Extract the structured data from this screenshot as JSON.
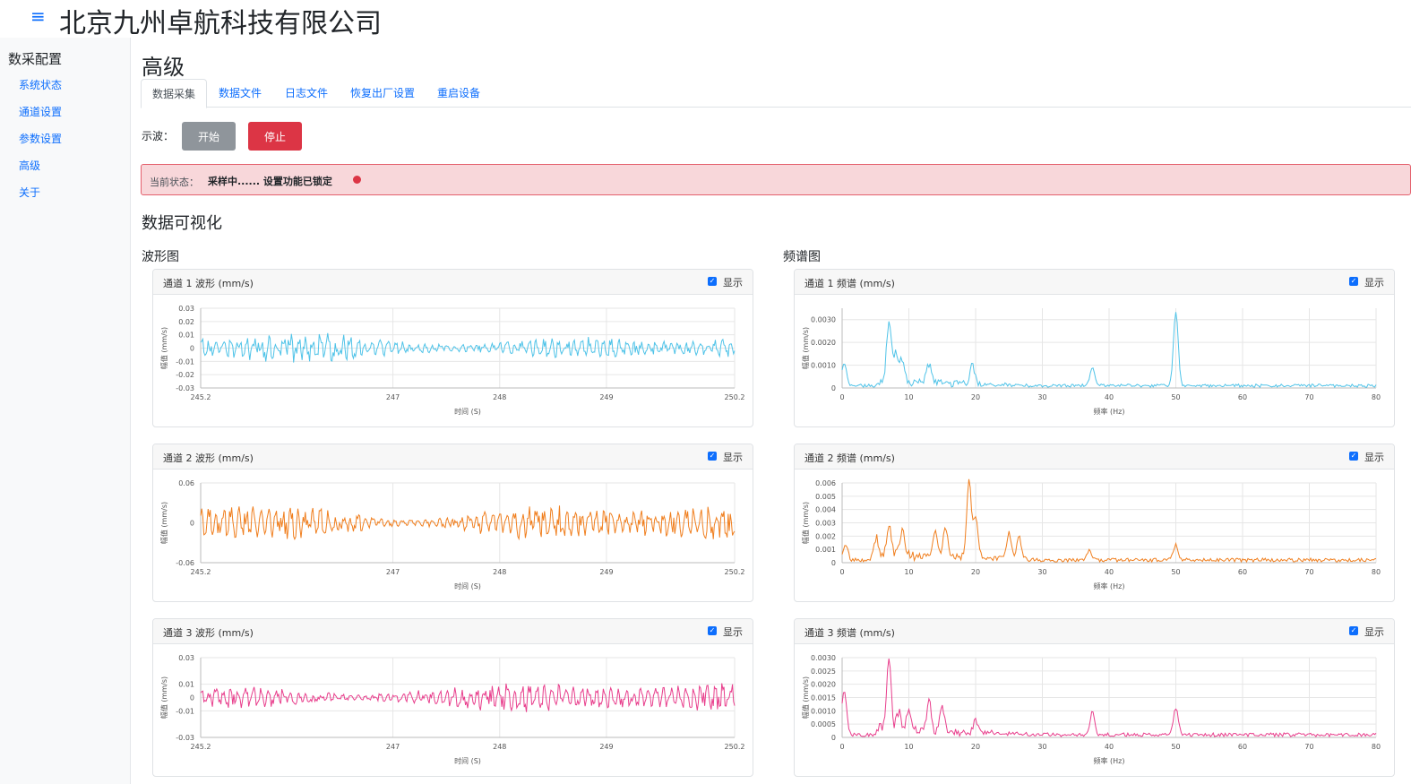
{
  "header": {
    "menu_icon": "hamburger-menu-icon",
    "title": "北京九州卓航科技有限公司"
  },
  "sidebar": {
    "heading": "数采配置",
    "items": [
      {
        "label": "系统状态"
      },
      {
        "label": "通道设置"
      },
      {
        "label": "参数设置"
      },
      {
        "label": "高级"
      },
      {
        "label": "关于"
      }
    ]
  },
  "page": {
    "title": "高级"
  },
  "tabs": [
    {
      "label": "数据采集",
      "active": true
    },
    {
      "label": "数据文件"
    },
    {
      "label": "日志文件"
    },
    {
      "label": "恢复出厂设置"
    },
    {
      "label": "重启设备"
    }
  ],
  "scope": {
    "label": "示波：",
    "start_label": "开始",
    "stop_label": "停止"
  },
  "status": {
    "label": "当前状态：",
    "text": "采样中...... 设置功能已锁定",
    "indicator_color": "#dc3545"
  },
  "visualization": {
    "title": "数据可视化",
    "waveform_title": "波形图",
    "spectrum_title": "频谱图",
    "show_label": "显示"
  },
  "chart_data": [
    {
      "type": "line",
      "title": "通道 1 波形 (mm/s)",
      "color": "#4fc3e8",
      "xlabel": "时间 (S)",
      "ylabel": "幅值 (mm/s)",
      "xlim": [
        245.2,
        250.2
      ],
      "x_ticks": [
        "245.2",
        "247",
        "248",
        "249",
        "250.2"
      ],
      "ylim": [
        -0.03,
        0.03
      ],
      "y_ticks": [
        "0.03",
        "0.02",
        "0.01",
        "0",
        "-0.01",
        "-0.02",
        "-0.03"
      ],
      "amplitude": 0.009,
      "n_points": 500,
      "show": true,
      "grid": true
    },
    {
      "type": "line",
      "title": "通道 2 波形 (mm/s)",
      "color": "#f07f1f",
      "xlabel": "时间 (S)",
      "ylabel": "幅值 (mm/s)",
      "xlim": [
        245.2,
        250.2
      ],
      "x_ticks": [
        "245.2",
        "247",
        "248",
        "249",
        "250.2"
      ],
      "ylim": [
        -0.06,
        0.06
      ],
      "y_ticks": [
        "0.06",
        "0",
        "-0.06"
      ],
      "amplitude": 0.025,
      "n_points": 500,
      "show": true,
      "grid": true
    },
    {
      "type": "line",
      "title": "通道 3 波形 (mm/s)",
      "color": "#e83e8c",
      "xlabel": "时间 (S)",
      "ylabel": "幅值 (mm/s)",
      "xlim": [
        245.2,
        250.2
      ],
      "x_ticks": [
        "245.2",
        "247",
        "248",
        "249",
        "250.2"
      ],
      "ylim": [
        -0.03,
        0.03
      ],
      "y_ticks": [
        "0.03",
        "0.01",
        "0",
        "-0.01",
        "-0.03"
      ],
      "amplitude": 0.009,
      "n_points": 500,
      "show": true,
      "grid": true
    },
    {
      "type": "line",
      "title": "通道 1 频谱 (mm/s)",
      "color": "#4fc3e8",
      "xlabel": "频率 (Hz)",
      "ylabel": "幅值 (mm/s)",
      "xlim": [
        0,
        80
      ],
      "x_ticks": [
        "0",
        "10",
        "20",
        "30",
        "40",
        "50",
        "60",
        "70",
        "80"
      ],
      "ylim": [
        0,
        0.0035
      ],
      "y_ticks": [
        "0.0030",
        "0.0020",
        "0.0010",
        "0"
      ],
      "baseline": 0.0001,
      "n_points": 400,
      "peaks": [
        [
          0.3,
          0.001
        ],
        [
          7,
          0.0025
        ],
        [
          8,
          0.0012
        ],
        [
          9,
          0.001
        ],
        [
          13,
          0.0008
        ],
        [
          19.5,
          0.0008
        ],
        [
          37.5,
          0.0008
        ],
        [
          50,
          0.0033
        ]
      ],
      "show": true,
      "grid": true
    },
    {
      "type": "line",
      "title": "通道 2 频谱 (mm/s)",
      "color": "#f07f1f",
      "xlabel": "频率 (Hz)",
      "ylabel": "幅值 (mm/s)",
      "xlim": [
        0,
        80
      ],
      "x_ticks": [
        "0",
        "10",
        "20",
        "30",
        "40",
        "50",
        "60",
        "70",
        "80"
      ],
      "ylim": [
        0,
        0.006
      ],
      "y_ticks": [
        "0.006",
        "0.005",
        "0.004",
        "0.003",
        "0.002",
        "0.001",
        "0"
      ],
      "baseline": 0.0002,
      "n_points": 400,
      "peaks": [
        [
          0.5,
          0.0012
        ],
        [
          5,
          0.0015
        ],
        [
          7,
          0.0022
        ],
        [
          9,
          0.002
        ],
        [
          14,
          0.002
        ],
        [
          15.5,
          0.0022
        ],
        [
          19,
          0.0057
        ],
        [
          20,
          0.003
        ],
        [
          25,
          0.002
        ],
        [
          26.5,
          0.0017
        ],
        [
          37,
          0.0007
        ],
        [
          50,
          0.0012
        ]
      ],
      "show": true,
      "grid": true
    },
    {
      "type": "line",
      "title": "通道 3 频谱 (mm/s)",
      "color": "#e83e8c",
      "xlabel": "频率 (Hz)",
      "ylabel": "幅值 (mm/s)",
      "xlim": [
        0,
        80
      ],
      "x_ticks": [
        "0",
        "10",
        "20",
        "30",
        "40",
        "50",
        "60",
        "70",
        "80"
      ],
      "ylim": [
        0,
        0.003
      ],
      "y_ticks": [
        "0.0030",
        "0.0025",
        "0.0020",
        "0.0015",
        "0.0010",
        "0.0005",
        "0"
      ],
      "baseline": 0.0001,
      "n_points": 400,
      "peaks": [
        [
          0.3,
          0.0017
        ],
        [
          7,
          0.0026
        ],
        [
          8.5,
          0.0007
        ],
        [
          10,
          0.0008
        ],
        [
          13,
          0.0012
        ],
        [
          15,
          0.0009
        ],
        [
          20,
          0.0005
        ],
        [
          37.5,
          0.0009
        ],
        [
          50,
          0.001
        ]
      ],
      "show": true,
      "grid": true
    }
  ]
}
